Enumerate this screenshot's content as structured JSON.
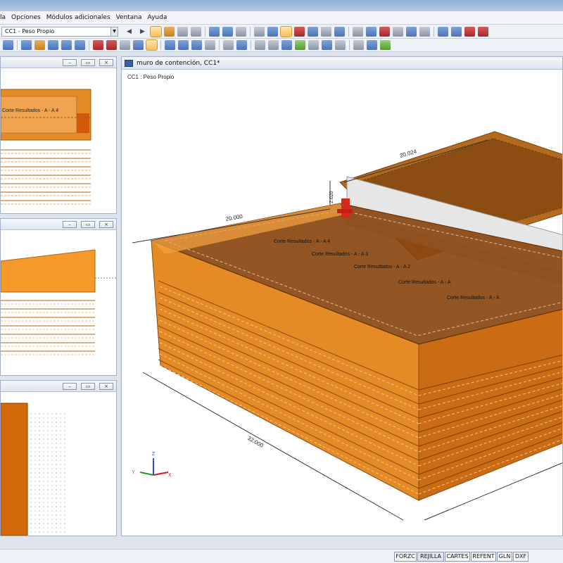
{
  "menu": [
    "la",
    "Opciones",
    "Módulos adicionales",
    "Ventana",
    "Ayuda"
  ],
  "toolbar": {
    "load_case": "CC1 - Peso Propio"
  },
  "main_window": {
    "title": "muro de contención, CC1*",
    "load_case_label": "CC1 : Peso Propio",
    "dimensions": {
      "d1": "20.024",
      "d2": "2.020",
      "d3": "20.000",
      "d4": "32.000"
    },
    "section_labels": [
      "Corte Resultados - A - A 4",
      "Corte Resultados - A - A 3",
      "Corte Resultados - A - A 2",
      "Corte Resultados - A - A",
      "Corte Resultados - A - A"
    ],
    "axes": {
      "z": "Z",
      "y": "Y",
      "x": "X"
    }
  },
  "side_window_1": {
    "label": "Corte Resultados - A - A 4"
  },
  "status_buttons": [
    "FORZC",
    "REJILLA",
    "CARTES",
    "REFENT",
    "GLN",
    "DXF"
  ],
  "colors": {
    "accent": "#e08a1e",
    "soil_dark": "#7a3e08",
    "window_border": "#9fb0c8"
  }
}
